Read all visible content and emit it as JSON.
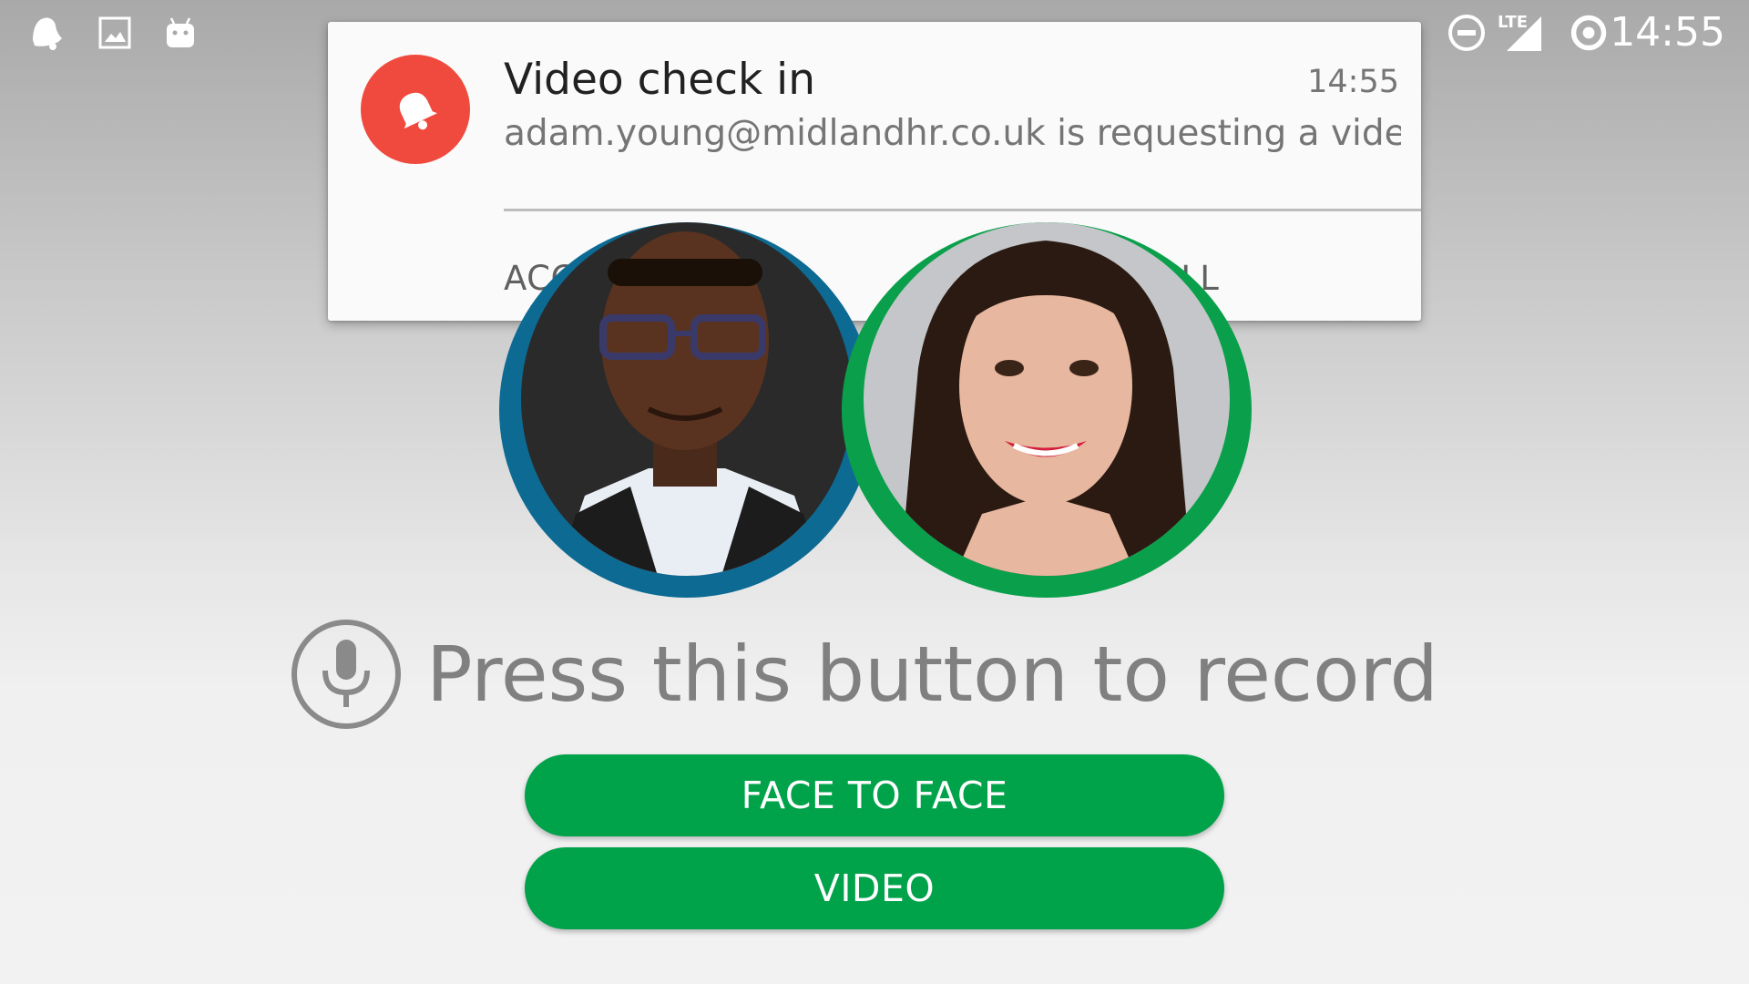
{
  "status_bar": {
    "icons_left": [
      "notification-bell-icon",
      "image-icon",
      "android-icon"
    ],
    "icons_right": [
      "do-not-disturb-icon",
      "lte-signal-icon",
      "data-saver-icon"
    ],
    "network_label": "LTE",
    "clock": "14:55"
  },
  "notification": {
    "app_icon": "bell-icon",
    "accent_color": "#f04a3e",
    "title": "Video check in",
    "time": "14:55",
    "body": "adam.young@midlandhr.co.uk is requesting a video..",
    "actions": {
      "accept": "ACCEPT CALL",
      "decline": "DECLINE CALL"
    }
  },
  "participants": [
    {
      "role": "caller",
      "ring_color": "#0d6a93"
    },
    {
      "role": "user",
      "ring_color": "#0aa04b"
    }
  ],
  "record": {
    "icon": "microphone-icon",
    "prompt": "Press this button to record"
  },
  "buttons": {
    "face_to_face": "FACE TO FACE",
    "video": "VIDEO",
    "color": "#00a24a"
  }
}
